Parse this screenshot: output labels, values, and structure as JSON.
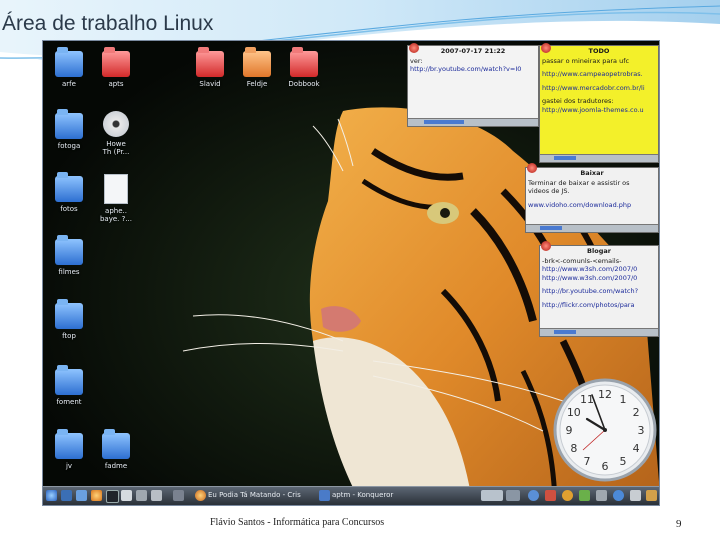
{
  "slide": {
    "title": "Área de trabalho Linux",
    "footer": "Flávio Santos - Informática para Concursos",
    "page_number": "9"
  },
  "desktop": {
    "icons": [
      {
        "label": "arfe",
        "icon": "folder-icon"
      },
      {
        "label": "apts",
        "icon": "folder-icon"
      },
      {
        "label": "Slavid",
        "icon": "folder-icon"
      },
      {
        "label": "Feldje",
        "icon": "folder-icon"
      },
      {
        "label": "Dobbook",
        "icon": "folder-icon"
      },
      {
        "label": "fotoga",
        "icon": "folder-icon"
      },
      {
        "label": "Howe\nTh (Pr...",
        "icon": "dvd-icon"
      },
      {
        "label": "fotos",
        "icon": "folder-icon"
      },
      {
        "label": "aphe..\nbaye. ?...",
        "icon": "file-icon"
      },
      {
        "label": "filmes",
        "icon": "folder-icon"
      },
      {
        "label": "ftop",
        "icon": "folder-icon"
      },
      {
        "label": "foment",
        "icon": "folder-icon"
      },
      {
        "label": "jv",
        "icon": "folder-icon"
      },
      {
        "label": "fadme",
        "icon": "folder-icon"
      }
    ],
    "notes": [
      {
        "title": "2007-07-17 21:22",
        "lines": [
          "ver:",
          "http://br.youtube.com/watch?v=I0"
        ]
      },
      {
        "title": "TODO",
        "lines": [
          "passar o mineirax para ufc",
          "",
          "http://www.campeaopetrobras.",
          "",
          "http://www.mercadobr.com.br/li",
          "",
          "gastei dos tradutores:",
          "http://www.joomla-themes.co.u"
        ]
      },
      {
        "title": "Baixar",
        "lines": [
          "Terminar de baixar e assistir os",
          "videos de JS.",
          "",
          "www.vidoho.com/download.php"
        ]
      },
      {
        "title": "Blogar",
        "lines": [
          "-brk<-comunls-<emails-",
          "http://www.w3sh.com/2007/0",
          "http://www.w3sh.com/2007/0",
          "",
          "http://br.youtube.com/watch?",
          "",
          "http://flickr.com/photos/para"
        ]
      }
    ],
    "clock": {
      "numerals": [
        "12",
        "1",
        "2",
        "3",
        "4",
        "5",
        "6",
        "7",
        "8",
        "9",
        "10",
        "11"
      ]
    },
    "taskbar": {
      "tasks": [
        "Eu Podia Tá Matando - Cris",
        "aptm - Konqueror"
      ]
    }
  }
}
